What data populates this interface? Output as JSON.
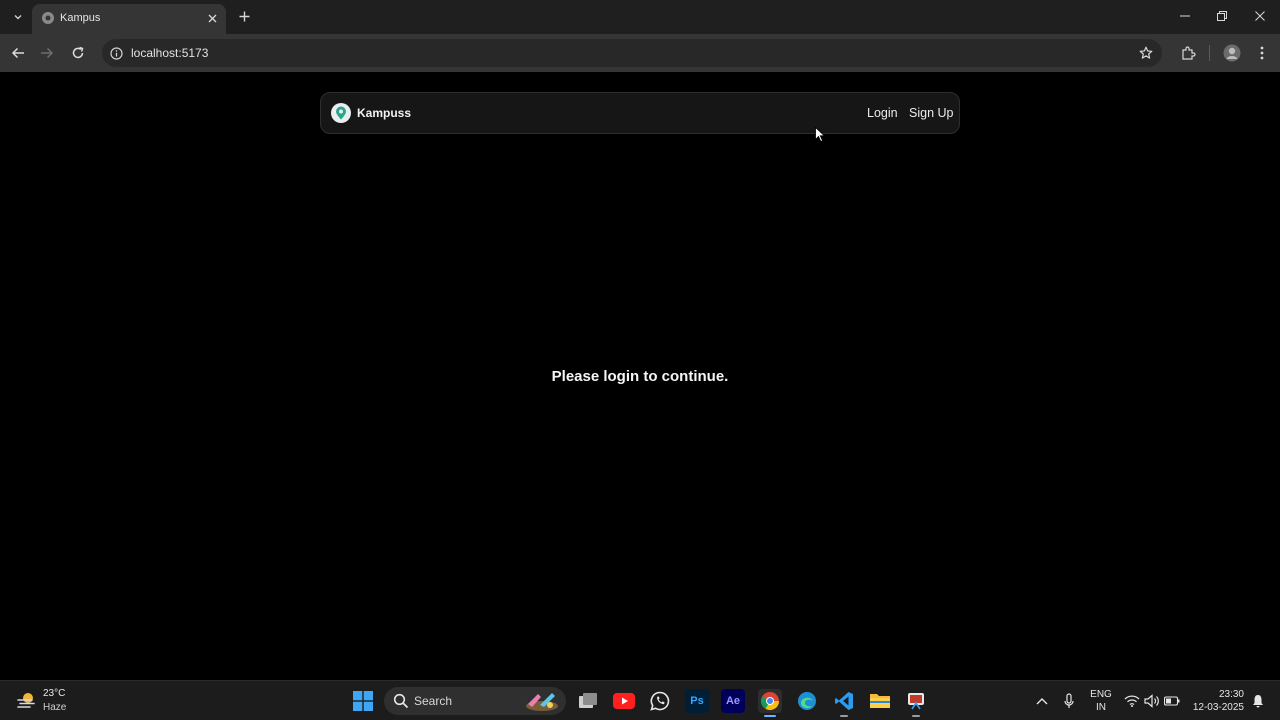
{
  "browser": {
    "tab_title": "Kampus",
    "address": "localhost:5173"
  },
  "navbar": {
    "brand": "Kampuss",
    "login_label": "Login",
    "signup_label": "Sign Up"
  },
  "main": {
    "message": "Please login to continue."
  },
  "taskbar": {
    "weather_temp": "23°C",
    "weather_condition": "Haze",
    "search_label": "Search",
    "apps": [
      "start-icon",
      "search",
      "task-view-icon",
      "youtube-icon",
      "whatsapp-icon",
      "photoshop-icon",
      "after-effects-icon",
      "chrome-icon",
      "edge-icon",
      "vscode-icon",
      "file-explorer-icon",
      "snipping-tool-icon"
    ],
    "photoshop_label": "Ps",
    "after_effects_label": "Ae",
    "lang_line1": "ENG",
    "lang_line2": "IN",
    "time": "23:30",
    "date": "12-03-2025"
  },
  "colors": {
    "page_bg": "#000000",
    "navbar_bg": "#161616",
    "toolbar_bg": "#353535",
    "tabstrip_bg": "#1f1f1f",
    "taskbar_bg": "#1c1c1c"
  }
}
